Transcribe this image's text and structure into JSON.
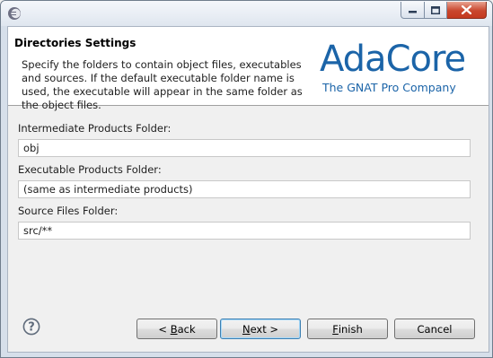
{
  "window": {
    "app_icon": "eclipse-icon",
    "controls": [
      "minimize-icon",
      "maximize-icon",
      "close-icon"
    ]
  },
  "header": {
    "title": "Directories Settings",
    "description": "Specify the folders to contain object files, executables and sources. If the default executable folder name is used, the executable will appear in the same folder as the object files.",
    "logo": {
      "name": "AdaCore",
      "tagline": "The GNAT Pro Company",
      "color": "#1b64a8"
    }
  },
  "fields": {
    "intermediate": {
      "label": "Intermediate Products Folder:",
      "value": "obj"
    },
    "executable": {
      "label": "Executable Products Folder:",
      "value": "(same as intermediate products)"
    },
    "source": {
      "label": "Source Files Folder:",
      "value": "src/**"
    }
  },
  "buttons": {
    "help_icon": "help-icon",
    "back": {
      "prefix": "< ",
      "mnemonic": "B",
      "rest": "ack"
    },
    "next": {
      "mnemonic": "N",
      "rest": "ext >"
    },
    "finish": {
      "mnemonic": "F",
      "rest": "inish"
    },
    "cancel": {
      "label": "Cancel"
    }
  }
}
